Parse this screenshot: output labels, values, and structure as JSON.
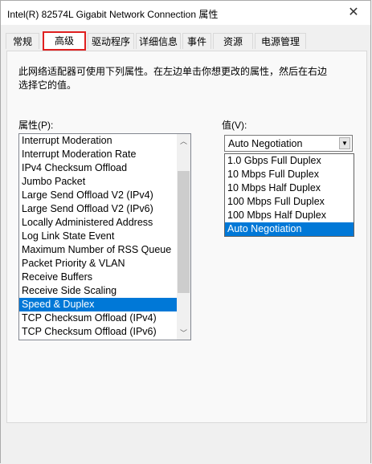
{
  "window": {
    "title": "Intel(R) 82574L Gigabit Network Connection 属性",
    "close_glyph": "✕"
  },
  "tabs": [
    {
      "label": "常规"
    },
    {
      "label": "高级"
    },
    {
      "label": "驱动程序"
    },
    {
      "label": "详细信息"
    },
    {
      "label": "事件"
    },
    {
      "label": "资源"
    },
    {
      "label": "电源管理"
    }
  ],
  "active_tab": "高级",
  "description": "此网络适配器可使用下列属性。在左边单击你想更改的属性，然后在右边选择它的值。",
  "properties_label": "属性(P):",
  "value_label": "值(V):",
  "properties": [
    {
      "label": "Interrupt Moderation"
    },
    {
      "label": "Interrupt Moderation Rate"
    },
    {
      "label": "IPv4 Checksum Offload"
    },
    {
      "label": "Jumbo Packet"
    },
    {
      "label": "Large Send Offload V2 (IPv4)"
    },
    {
      "label": "Large Send Offload V2 (IPv6)"
    },
    {
      "label": "Locally Administered Address"
    },
    {
      "label": "Log Link State Event"
    },
    {
      "label": "Maximum Number of RSS Queue"
    },
    {
      "label": "Packet Priority & VLAN"
    },
    {
      "label": "Receive Buffers"
    },
    {
      "label": "Receive Side Scaling"
    },
    {
      "label": "Speed & Duplex"
    },
    {
      "label": "TCP Checksum Offload (IPv4)"
    },
    {
      "label": "TCP Checksum Offload (IPv6)"
    }
  ],
  "selected_property": "Speed & Duplex",
  "combo": {
    "value": "Auto Negotiation",
    "arrow_glyph": "▼"
  },
  "value_options": [
    {
      "label": "1.0 Gbps Full Duplex"
    },
    {
      "label": "10 Mbps Full Duplex"
    },
    {
      "label": "10 Mbps Half Duplex"
    },
    {
      "label": "100 Mbps Full Duplex"
    },
    {
      "label": "100 Mbps Half Duplex"
    },
    {
      "label": "Auto Negotiation"
    }
  ],
  "selected_value": "Auto Negotiation",
  "scrollbar": {
    "up_glyph": "︿",
    "down_glyph": "﹀"
  },
  "colors": {
    "selection": "#0078d7",
    "active_tab_highlight": "#e02020"
  }
}
